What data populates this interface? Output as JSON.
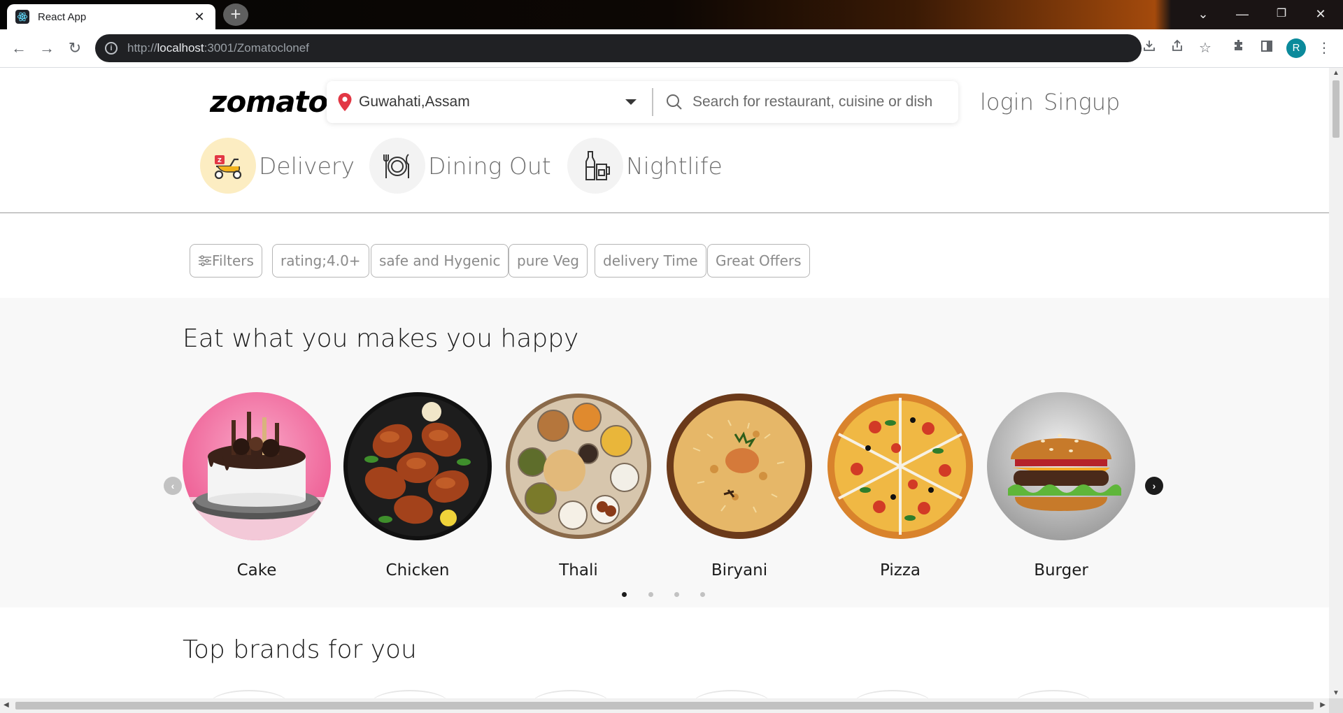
{
  "browser": {
    "tab_title": "React App",
    "url_prefix": "http://",
    "url_host": "localhost",
    "url_path": ":3001/Zomatoclonef",
    "profile_initial": "R"
  },
  "header": {
    "logo": "zomato",
    "location": "Guwahati,Assam",
    "search_placeholder": "Search for restaurant, cuisine or dish",
    "login": "login",
    "signup": "Singup"
  },
  "categories": [
    {
      "label": "Delivery",
      "icon": "scooter-icon",
      "active": true
    },
    {
      "label": "Dining Out",
      "icon": "dining-plate-icon",
      "active": false
    },
    {
      "label": "Nightlife",
      "icon": "bottle-glass-icon",
      "active": false
    }
  ],
  "filters": [
    {
      "label": "Filters",
      "icon": "sliders-icon"
    },
    {
      "label": "rating;4.0+"
    },
    {
      "label": "safe and Hygenic"
    },
    {
      "label": "pure Veg"
    },
    {
      "label": "delivery Time"
    },
    {
      "label": "Great Offers"
    }
  ],
  "happy_section": {
    "title": "Eat what you makes you happy",
    "items": [
      {
        "name": "Cake"
      },
      {
        "name": "Chicken"
      },
      {
        "name": "Thali"
      },
      {
        "name": "Biryani"
      },
      {
        "name": "Pizza"
      },
      {
        "name": "Burger"
      }
    ],
    "active_dot": 0,
    "dot_count": 4
  },
  "brands_section": {
    "title": "Top brands for you"
  },
  "colors": {
    "brand_red": "#e23744",
    "delivery_bg": "#fcedc2",
    "band_bg": "#f8f8f8"
  }
}
